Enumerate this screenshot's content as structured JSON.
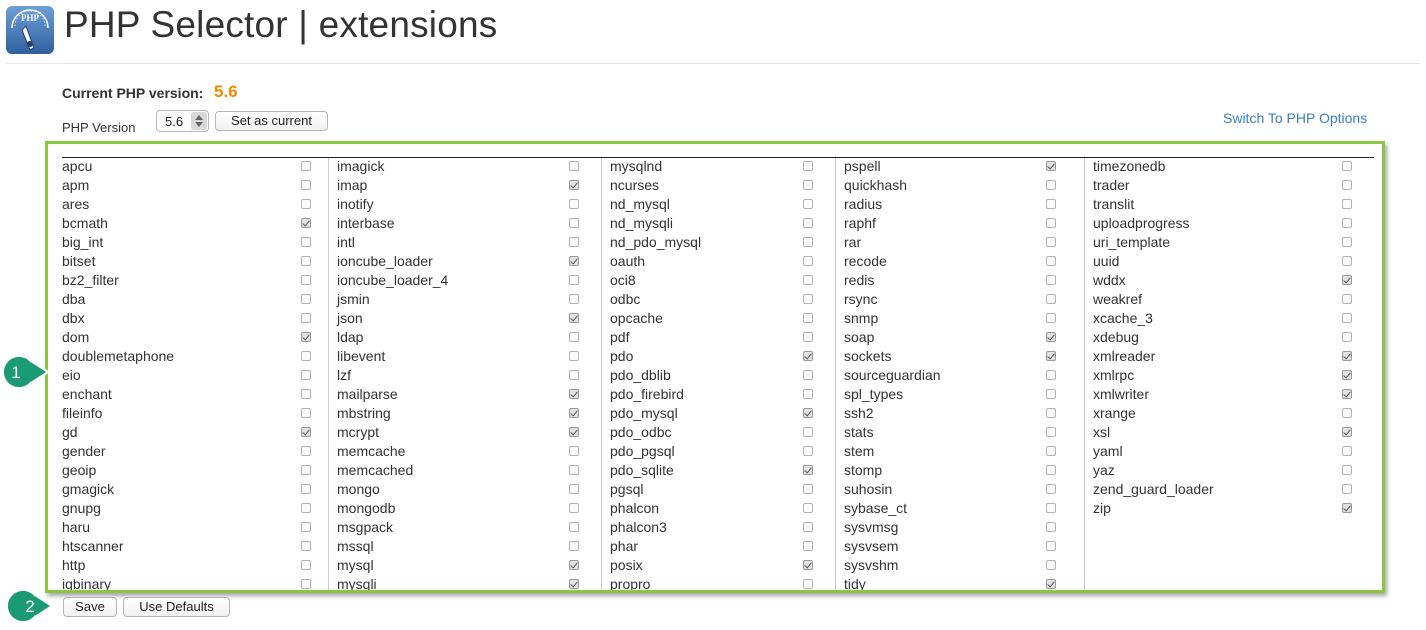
{
  "header": {
    "title": "PHP Selector | extensions",
    "logo_label": "PHP",
    "logo_icon": "php-selector-logo-icon"
  },
  "current": {
    "label": "Current PHP version:",
    "value": "5.6"
  },
  "version": {
    "label": "PHP Version",
    "selected": "5.6",
    "set_current_label": "Set as current"
  },
  "switch_link": "Switch To PHP Options",
  "actions": {
    "save_label": "Save",
    "defaults_label": "Use Defaults"
  },
  "callouts": {
    "one": "1",
    "two": "2"
  },
  "colors": {
    "accent_border": "#8cc63f",
    "version_value": "#f08a00",
    "link": "#3a7fc4",
    "callout_fill": "#1a9b73"
  },
  "extension_columns": [
    [
      {
        "name": "apcu",
        "checked": false
      },
      {
        "name": "apm",
        "checked": false
      },
      {
        "name": "ares",
        "checked": false
      },
      {
        "name": "bcmath",
        "checked": true
      },
      {
        "name": "big_int",
        "checked": false
      },
      {
        "name": "bitset",
        "checked": false
      },
      {
        "name": "bz2_filter",
        "checked": false
      },
      {
        "name": "dba",
        "checked": false
      },
      {
        "name": "dbx",
        "checked": false
      },
      {
        "name": "dom",
        "checked": true
      },
      {
        "name": "doublemetaphone",
        "checked": false
      },
      {
        "name": "eio",
        "checked": false
      },
      {
        "name": "enchant",
        "checked": false
      },
      {
        "name": "fileinfo",
        "checked": false
      },
      {
        "name": "gd",
        "checked": true
      },
      {
        "name": "gender",
        "checked": false
      },
      {
        "name": "geoip",
        "checked": false
      },
      {
        "name": "gmagick",
        "checked": false
      },
      {
        "name": "gnupg",
        "checked": false
      },
      {
        "name": "haru",
        "checked": false
      },
      {
        "name": "htscanner",
        "checked": false
      },
      {
        "name": "http",
        "checked": false
      },
      {
        "name": "igbinary",
        "checked": false
      }
    ],
    [
      {
        "name": "imagick",
        "checked": false
      },
      {
        "name": "imap",
        "checked": true
      },
      {
        "name": "inotify",
        "checked": false
      },
      {
        "name": "interbase",
        "checked": false
      },
      {
        "name": "intl",
        "checked": false
      },
      {
        "name": "ioncube_loader",
        "checked": true
      },
      {
        "name": "ioncube_loader_4",
        "checked": false
      },
      {
        "name": "jsmin",
        "checked": false
      },
      {
        "name": "json",
        "checked": true
      },
      {
        "name": "ldap",
        "checked": false
      },
      {
        "name": "libevent",
        "checked": false
      },
      {
        "name": "lzf",
        "checked": false
      },
      {
        "name": "mailparse",
        "checked": true
      },
      {
        "name": "mbstring",
        "checked": true
      },
      {
        "name": "mcrypt",
        "checked": true
      },
      {
        "name": "memcache",
        "checked": false
      },
      {
        "name": "memcached",
        "checked": false
      },
      {
        "name": "mongo",
        "checked": false
      },
      {
        "name": "mongodb",
        "checked": false
      },
      {
        "name": "msgpack",
        "checked": false
      },
      {
        "name": "mssql",
        "checked": false
      },
      {
        "name": "mysql",
        "checked": true
      },
      {
        "name": "mysqli",
        "checked": true
      }
    ],
    [
      {
        "name": "mysqlnd",
        "checked": false
      },
      {
        "name": "ncurses",
        "checked": false
      },
      {
        "name": "nd_mysql",
        "checked": false
      },
      {
        "name": "nd_mysqli",
        "checked": false
      },
      {
        "name": "nd_pdo_mysql",
        "checked": false
      },
      {
        "name": "oauth",
        "checked": false
      },
      {
        "name": "oci8",
        "checked": false
      },
      {
        "name": "odbc",
        "checked": false
      },
      {
        "name": "opcache",
        "checked": false
      },
      {
        "name": "pdf",
        "checked": false
      },
      {
        "name": "pdo",
        "checked": true
      },
      {
        "name": "pdo_dblib",
        "checked": false
      },
      {
        "name": "pdo_firebird",
        "checked": false
      },
      {
        "name": "pdo_mysql",
        "checked": true
      },
      {
        "name": "pdo_odbc",
        "checked": false
      },
      {
        "name": "pdo_pgsql",
        "checked": false
      },
      {
        "name": "pdo_sqlite",
        "checked": true
      },
      {
        "name": "pgsql",
        "checked": false
      },
      {
        "name": "phalcon",
        "checked": false
      },
      {
        "name": "phalcon3",
        "checked": false
      },
      {
        "name": "phar",
        "checked": false
      },
      {
        "name": "posix",
        "checked": true
      },
      {
        "name": "propro",
        "checked": false
      }
    ],
    [
      {
        "name": "pspell",
        "checked": true
      },
      {
        "name": "quickhash",
        "checked": false
      },
      {
        "name": "radius",
        "checked": false
      },
      {
        "name": "raphf",
        "checked": false
      },
      {
        "name": "rar",
        "checked": false
      },
      {
        "name": "recode",
        "checked": false
      },
      {
        "name": "redis",
        "checked": false
      },
      {
        "name": "rsync",
        "checked": false
      },
      {
        "name": "snmp",
        "checked": false
      },
      {
        "name": "soap",
        "checked": true
      },
      {
        "name": "sockets",
        "checked": true
      },
      {
        "name": "sourceguardian",
        "checked": false
      },
      {
        "name": "spl_types",
        "checked": false
      },
      {
        "name": "ssh2",
        "checked": false
      },
      {
        "name": "stats",
        "checked": false
      },
      {
        "name": "stem",
        "checked": false
      },
      {
        "name": "stomp",
        "checked": false
      },
      {
        "name": "suhosin",
        "checked": false
      },
      {
        "name": "sybase_ct",
        "checked": false
      },
      {
        "name": "sysvmsg",
        "checked": false
      },
      {
        "name": "sysvsem",
        "checked": false
      },
      {
        "name": "sysvshm",
        "checked": false
      },
      {
        "name": "tidy",
        "checked": true
      }
    ],
    [
      {
        "name": "timezonedb",
        "checked": false
      },
      {
        "name": "trader",
        "checked": false
      },
      {
        "name": "translit",
        "checked": false
      },
      {
        "name": "uploadprogress",
        "checked": false
      },
      {
        "name": "uri_template",
        "checked": false
      },
      {
        "name": "uuid",
        "checked": false
      },
      {
        "name": "wddx",
        "checked": true
      },
      {
        "name": "weakref",
        "checked": false
      },
      {
        "name": "xcache_3",
        "checked": false
      },
      {
        "name": "xdebug",
        "checked": false
      },
      {
        "name": "xmlreader",
        "checked": true
      },
      {
        "name": "xmlrpc",
        "checked": true
      },
      {
        "name": "xmlwriter",
        "checked": true
      },
      {
        "name": "xrange",
        "checked": false
      },
      {
        "name": "xsl",
        "checked": true
      },
      {
        "name": "yaml",
        "checked": false
      },
      {
        "name": "yaz",
        "checked": false
      },
      {
        "name": "zend_guard_loader",
        "checked": false
      },
      {
        "name": "zip",
        "checked": true
      }
    ]
  ]
}
